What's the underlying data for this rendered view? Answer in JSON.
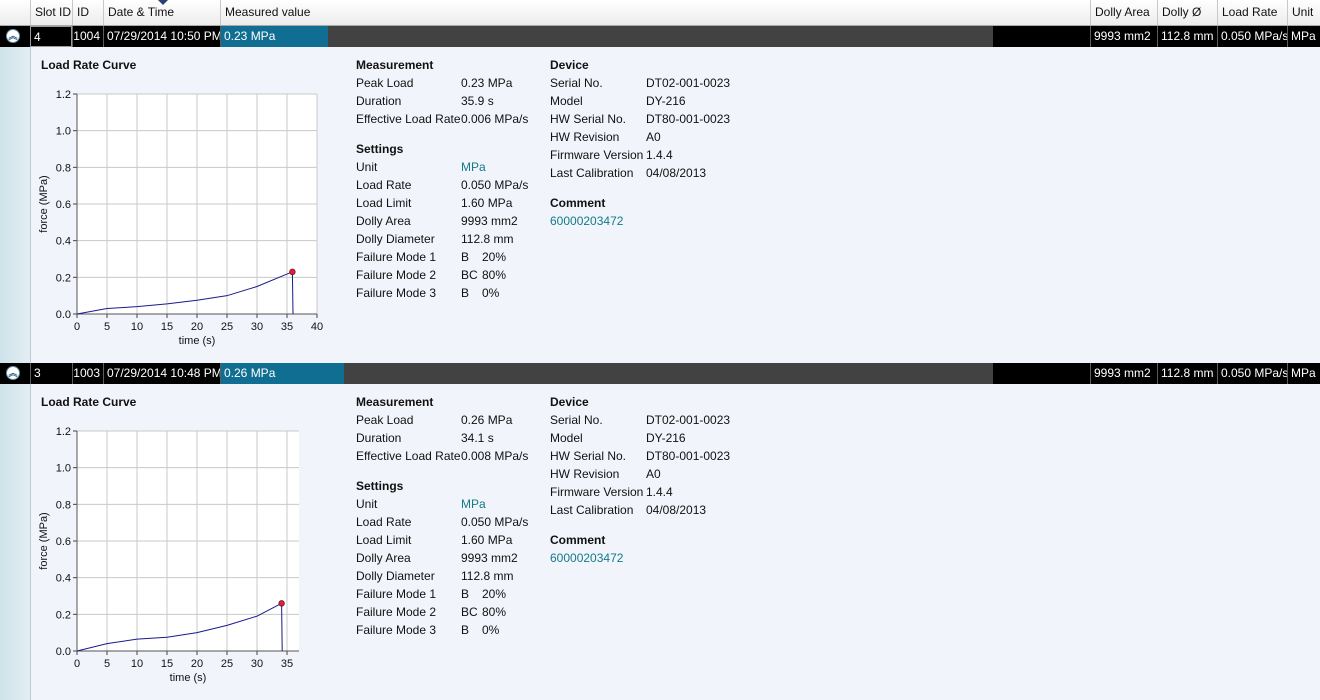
{
  "columns": {
    "slot_id": "Slot ID",
    "id": "ID",
    "date_time": "Date & Time",
    "measured_value": "Measured value",
    "dolly_area": "Dolly Area",
    "dolly_d": "Dolly Ø",
    "load_rate": "Load Rate",
    "unit": "Unit"
  },
  "records": [
    {
      "row": {
        "slot_id": "4",
        "id": "1004",
        "date_time": "07/29/2014 10:50 PM",
        "measured_value": "0.23 MPa",
        "dolly_area": "9993 mm2",
        "dolly_d": "112.8 mm",
        "load_rate": "0.050 MPa/s",
        "unit": "MPa"
      },
      "chart_title": "Load Rate Curve",
      "measurement": {
        "title": "Measurement",
        "items": [
          {
            "label": "Peak Load",
            "value": "0.23 MPa"
          },
          {
            "label": "Duration",
            "value": "35.9 s"
          },
          {
            "label": "Effective Load Rate",
            "value": "0.006 MPa/s"
          }
        ]
      },
      "settings": {
        "title": "Settings",
        "items": [
          {
            "label": "Unit",
            "value": "MPa"
          },
          {
            "label": "Load Rate",
            "value": "0.050 MPa/s"
          },
          {
            "label": "Load Limit",
            "value": "1.60 MPa"
          },
          {
            "label": "Dolly Area",
            "value": "9993 mm2"
          },
          {
            "label": "Dolly Diameter",
            "value": "112.8 mm"
          },
          {
            "label": "Failure Mode 1",
            "code": "B",
            "pct": "20%"
          },
          {
            "label": "Failure Mode 2",
            "code": "BC",
            "pct": "80%"
          },
          {
            "label": "Failure Mode 3",
            "code": "B",
            "pct": "0%"
          }
        ]
      },
      "device": {
        "title": "Device",
        "items": [
          {
            "label": "Serial No.",
            "value": "DT02-001-0023"
          },
          {
            "label": "Model",
            "value": "DY-216"
          },
          {
            "label": "HW Serial No.",
            "value": "DT80-001-0023"
          },
          {
            "label": "HW Revision",
            "value": "A0"
          },
          {
            "label": "Firmware Version",
            "value": "1.4.4"
          },
          {
            "label": "Last Calibration",
            "value": "04/08/2013"
          }
        ]
      },
      "comment": {
        "title": "Comment",
        "value": "60000203472"
      }
    },
    {
      "row": {
        "slot_id": "3",
        "id": "1003",
        "date_time": "07/29/2014 10:48 PM",
        "measured_value": "0.26 MPa",
        "dolly_area": "9993 mm2",
        "dolly_d": "112.8 mm",
        "load_rate": "0.050 MPa/s",
        "unit": "MPa"
      },
      "chart_title": "Load Rate Curve",
      "measurement": {
        "title": "Measurement",
        "items": [
          {
            "label": "Peak Load",
            "value": "0.26 MPa"
          },
          {
            "label": "Duration",
            "value": "34.1 s"
          },
          {
            "label": "Effective Load Rate",
            "value": "0.008 MPa/s"
          }
        ]
      },
      "settings": {
        "title": "Settings",
        "items": [
          {
            "label": "Unit",
            "value": "MPa"
          },
          {
            "label": "Load Rate",
            "value": "0.050 MPa/s"
          },
          {
            "label": "Load Limit",
            "value": "1.60 MPa"
          },
          {
            "label": "Dolly Area",
            "value": "9993 mm2"
          },
          {
            "label": "Dolly Diameter",
            "value": "112.8 mm"
          },
          {
            "label": "Failure Mode 1",
            "code": "B",
            "pct": "20%"
          },
          {
            "label": "Failure Mode 2",
            "code": "BC",
            "pct": "80%"
          },
          {
            "label": "Failure Mode 3",
            "code": "B",
            "pct": "0%"
          }
        ]
      },
      "device": {
        "title": "Device",
        "items": [
          {
            "label": "Serial No.",
            "value": "DT02-001-0023"
          },
          {
            "label": "Model",
            "value": "DY-216"
          },
          {
            "label": "HW Serial No.",
            "value": "DT80-001-0023"
          },
          {
            "label": "HW Revision",
            "value": "A0"
          },
          {
            "label": "Firmware Version",
            "value": "1.4.4"
          },
          {
            "label": "Last Calibration",
            "value": "04/08/2013"
          }
        ]
      },
      "comment": {
        "title": "Comment",
        "value": "60000203472"
      }
    }
  ],
  "chart_data": [
    {
      "type": "line",
      "xlabel": "time (s)",
      "ylabel": "force (MPa)",
      "xlim": [
        0,
        40
      ],
      "ylim": [
        0,
        1.2
      ],
      "xticks": [
        "0",
        "5",
        "10",
        "15",
        "20",
        "25",
        "30",
        "35",
        "40"
      ],
      "yticks": [
        "0.0",
        "0.2",
        "0.4",
        "0.6",
        "0.8",
        "1.0",
        "1.2"
      ],
      "grid": true,
      "series": [
        {
          "x": [
            0,
            5,
            10,
            15,
            20,
            25,
            30,
            35.9,
            36.0
          ],
          "y": [
            0.0,
            0.03,
            0.04,
            0.055,
            0.075,
            0.1,
            0.15,
            0.23,
            0.0
          ]
        }
      ],
      "peak": {
        "x": 35.9,
        "y": 0.23
      }
    },
    {
      "type": "line",
      "xlabel": "time (s)",
      "ylabel": "force (MPa)",
      "xlim": [
        0,
        37
      ],
      "ylim": [
        0,
        1.2
      ],
      "xticks": [
        "0",
        "5",
        "10",
        "15",
        "20",
        "25",
        "30",
        "35"
      ],
      "yticks": [
        "0.0",
        "0.2",
        "0.4",
        "0.6",
        "0.8",
        "1.0",
        "1.2"
      ],
      "grid": true,
      "series": [
        {
          "x": [
            0,
            5,
            10,
            15,
            20,
            25,
            30,
            34.1,
            34.2
          ],
          "y": [
            0.0,
            0.04,
            0.065,
            0.075,
            0.1,
            0.14,
            0.19,
            0.26,
            0.0
          ]
        }
      ],
      "peak": {
        "x": 34.1,
        "y": 0.26
      }
    }
  ]
}
